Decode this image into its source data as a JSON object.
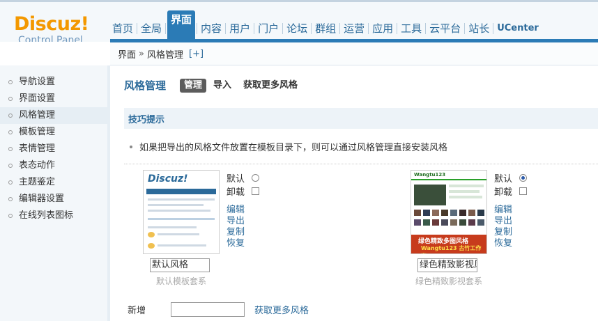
{
  "logo": {
    "name": "Discuz!",
    "subtitle": "Control Panel"
  },
  "nav": {
    "items": [
      {
        "label": "首页"
      },
      {
        "label": "全局"
      },
      {
        "label": "界面",
        "active": true
      },
      {
        "label": "内容"
      },
      {
        "label": "用户"
      },
      {
        "label": "门户"
      },
      {
        "label": "论坛"
      },
      {
        "label": "群组"
      },
      {
        "label": "运营"
      },
      {
        "label": "应用"
      },
      {
        "label": "工具"
      },
      {
        "label": "云平台"
      },
      {
        "label": "站长"
      },
      {
        "label": "UCenter"
      }
    ]
  },
  "breadcrumb": {
    "root": "界面",
    "separator": "»",
    "current": "风格管理",
    "add": "[+]"
  },
  "sidebar": {
    "items": [
      {
        "label": "导航设置"
      },
      {
        "label": "界面设置"
      },
      {
        "label": "风格管理",
        "active": true
      },
      {
        "label": "模板管理"
      },
      {
        "label": "表情管理"
      },
      {
        "label": "表态动作"
      },
      {
        "label": "主题鉴定"
      },
      {
        "label": "编辑器设置"
      },
      {
        "label": "在线列表图标"
      }
    ]
  },
  "main": {
    "title": "风格管理",
    "tabs": [
      {
        "label": "管理",
        "active": true
      },
      {
        "label": "导入"
      },
      {
        "label": "获取更多风格"
      }
    ],
    "tips_title": "技巧提示",
    "tips_text": "如果把导出的风格文件放置在模板目录下，则可以通过风格管理直接安装风格",
    "styles": [
      {
        "default_label": "默认",
        "uninstall_label": "卸载",
        "default_selected": false,
        "actions": [
          "编辑",
          "导出",
          "复制",
          "恢复"
        ],
        "name_value": "默认风格",
        "kit": "默认模板套系",
        "thumb": {
          "logo": "Discuz!"
        }
      },
      {
        "default_label": "默认",
        "uninstall_label": "卸载",
        "default_selected": true,
        "actions": [
          "编辑",
          "导出",
          "复制",
          "恢复"
        ],
        "name_value": "绿色精致影视风",
        "kit": "绿色精致影视套系",
        "thumb": {
          "logo": "Wangtu123",
          "banner1": "绿色精致多图风格",
          "banner2": "Wangtu123 古竹工作室"
        }
      }
    ],
    "add_row": {
      "label": "新增",
      "input_value": "",
      "link": "获取更多风格"
    }
  },
  "colors": {
    "accent": "#2b7bb6",
    "logo": "#f39800",
    "link": "#2b6a9a"
  }
}
